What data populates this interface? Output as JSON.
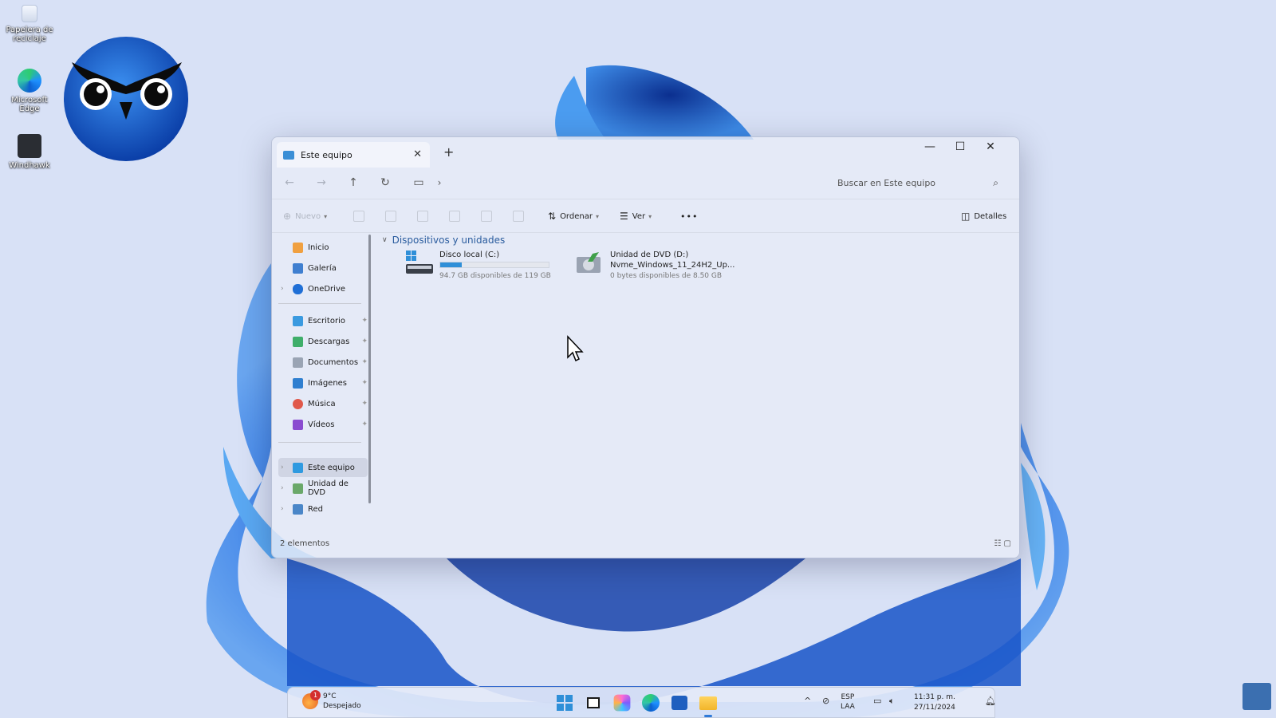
{
  "desktop": {
    "icons": [
      {
        "label": "Papelera de reciclaje"
      },
      {
        "label": "Microsoft Edge"
      },
      {
        "label": "Windhawk"
      }
    ]
  },
  "explorer": {
    "tab_title": "Este equipo",
    "search_placeholder": "Buscar en Este equipo",
    "commands": {
      "new": "Nuevo",
      "sort": "Ordenar",
      "view": "Ver",
      "more": "•••",
      "details": "Detalles"
    },
    "sidebar": {
      "items": [
        {
          "label": "Inicio",
          "icon": "home-icon"
        },
        {
          "label": "Galería",
          "icon": "gallery-icon"
        },
        {
          "label": "OneDrive",
          "icon": "cloud-icon"
        },
        {
          "label": "Escritorio",
          "icon": "desktop-icon"
        },
        {
          "label": "Descargas",
          "icon": "download-icon"
        },
        {
          "label": "Documentos",
          "icon": "document-icon"
        },
        {
          "label": "Imágenes",
          "icon": "pictures-icon"
        },
        {
          "label": "Música",
          "icon": "music-icon"
        },
        {
          "label": "Vídeos",
          "icon": "video-icon"
        },
        {
          "label": "Este equipo",
          "icon": "pc-icon"
        },
        {
          "label": "Unidad de DVD",
          "icon": "dvd-icon"
        },
        {
          "label": "Red",
          "icon": "network-icon"
        }
      ]
    },
    "group_title": "Dispositivos y unidades",
    "drives": [
      {
        "name": "Disco local (C:)",
        "free": "94.7 GB disponibles de 119 GB",
        "used_fraction": 0.2
      },
      {
        "name": "Unidad de DVD (D:)",
        "volume": "Nvme_Windows_11_24H2_Up...",
        "free": "0 bytes disponibles de 8.50 GB"
      }
    ],
    "status": "2 elementos"
  },
  "taskbar": {
    "weather_temp": "9°C",
    "weather_desc": "Despejado",
    "weather_badge": "1",
    "lang_top": "ESP",
    "lang_bottom": "LAA",
    "time": "11:31 p. m.",
    "date": "27/11/2024"
  },
  "colors": {
    "accent": "#2f8fd8",
    "window_bg": "#e8ecf7",
    "wallpaper": "#d6e0f6"
  }
}
